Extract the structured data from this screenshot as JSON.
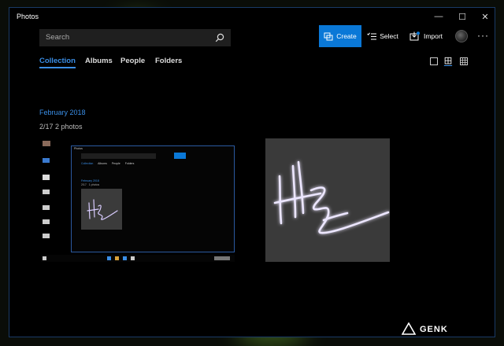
{
  "window": {
    "title": "Photos"
  },
  "window_controls": {
    "minimize": "—",
    "maximize": "☐",
    "close": "✕"
  },
  "toolbar": {
    "search_placeholder": "Search",
    "create_label": "Create",
    "select_label": "Select",
    "import_label": "Import",
    "more_label": "···"
  },
  "tabs": [
    {
      "label": "Collection",
      "active": true
    },
    {
      "label": "Albums"
    },
    {
      "label": "People"
    },
    {
      "label": "Folders"
    }
  ],
  "collection": {
    "month": "February 2018",
    "date_line": "2/17   2 photos"
  },
  "screenshot_thumbnail": {
    "window_title": "Photos",
    "tabs": [
      "Collection",
      "Albums",
      "People",
      "Folders"
    ],
    "month": "February 2018",
    "date_line": "2/17   1 photos"
  },
  "watermark": {
    "text": "GENK"
  },
  "colors": {
    "accent": "#0a78d7",
    "tab_active": "#3a8ee6",
    "signature_glow": "#b9a6ff"
  }
}
